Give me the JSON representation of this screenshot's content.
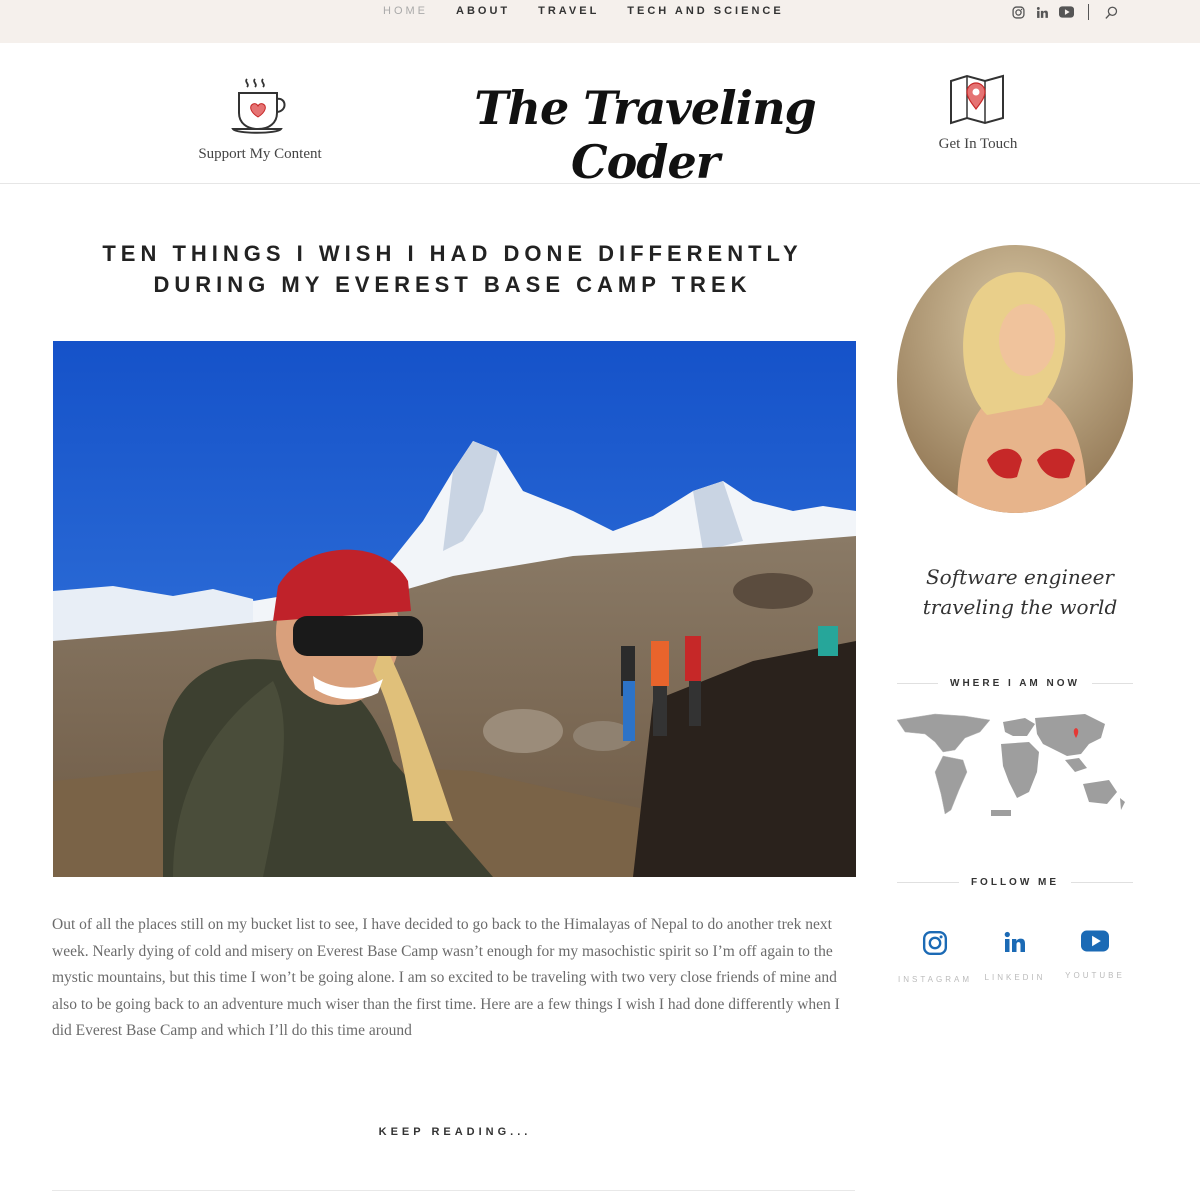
{
  "nav": {
    "items": [
      {
        "label": "HOME",
        "active": true
      },
      {
        "label": "ABOUT"
      },
      {
        "label": "TRAVEL"
      },
      {
        "label": "TECH AND SCIENCE"
      }
    ],
    "icons": [
      "instagram-icon",
      "linkedin-icon",
      "youtube-icon",
      "search-icon"
    ]
  },
  "header": {
    "logo": "The Traveling Coder",
    "support_label": "Support My Content",
    "touch_label": "Get In Touch"
  },
  "post": {
    "title": "TEN THINGS I WISH I HAD DONE DIFFERENTLY DURING MY EVEREST BASE CAMP TREK",
    "excerpt": "Out of all the places still on my bucket list to see, I have decided to go back to the Himalayas of Nepal to do another trek next week. Nearly dying of cold and misery on Everest Base Camp wasn’t enough for my masochistic spirit so I’m off again to the mystic mountains, but this time I won’t be going alone. I am so excited to be traveling with two very close friends of mine and also to be going back to an adventure much wiser than the first time. Here are a few things I wish I had done differently when I did Everest Base Camp and which I’ll do this time around",
    "keep_reading": "KEEP READING..."
  },
  "sidebar": {
    "tagline": "Software engineer traveling the world",
    "where_title": "WHERE I AM NOW",
    "follow_title": "FOLLOW ME",
    "social": [
      {
        "label": "INSTAGRAM",
        "icon": "instagram-icon"
      },
      {
        "label": "LINKEDIN",
        "icon": "linkedin-icon"
      },
      {
        "label": "YOUTUBE",
        "icon": "youtube-icon"
      }
    ]
  },
  "colors": {
    "topbar_bg": "#f5f0ec",
    "accent_blue": "#1b6ab5",
    "pin_red": "#e53935"
  }
}
